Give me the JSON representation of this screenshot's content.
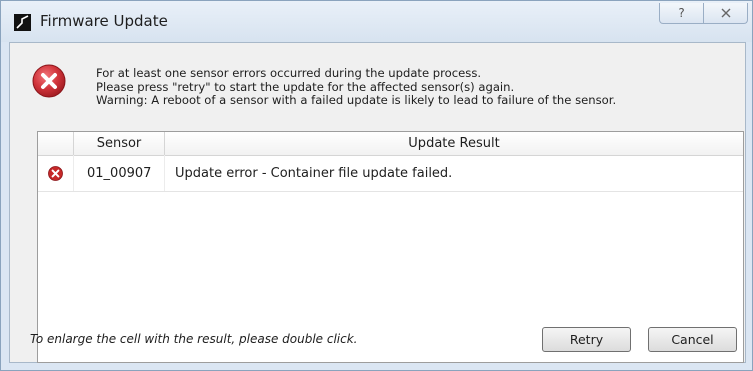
{
  "window": {
    "title": "Firmware Update",
    "help_label": "?",
    "close_label": "☒"
  },
  "message": {
    "line1": "For at least one sensor errors occurred during the update process.",
    "line2": "Please press \"retry\" to start the update for the affected sensor(s) again.",
    "line3": "Warning: A reboot of a sensor with a failed update is likely to lead to failure of the sensor."
  },
  "table": {
    "columns": [
      "",
      "Sensor",
      "Update Result"
    ],
    "rows": [
      {
        "status_icon": "error-icon",
        "sensor": "01_00907",
        "result": "Update error - Container file update failed."
      }
    ]
  },
  "footer": {
    "hint": "To enlarge the cell with the result, please double click.",
    "retry_label": "Retry",
    "cancel_label": "Cancel"
  },
  "colors": {
    "error_red": "#c62828",
    "titlebar_bg": "#dbe6f3",
    "client_bg": "#f0f0f0"
  }
}
